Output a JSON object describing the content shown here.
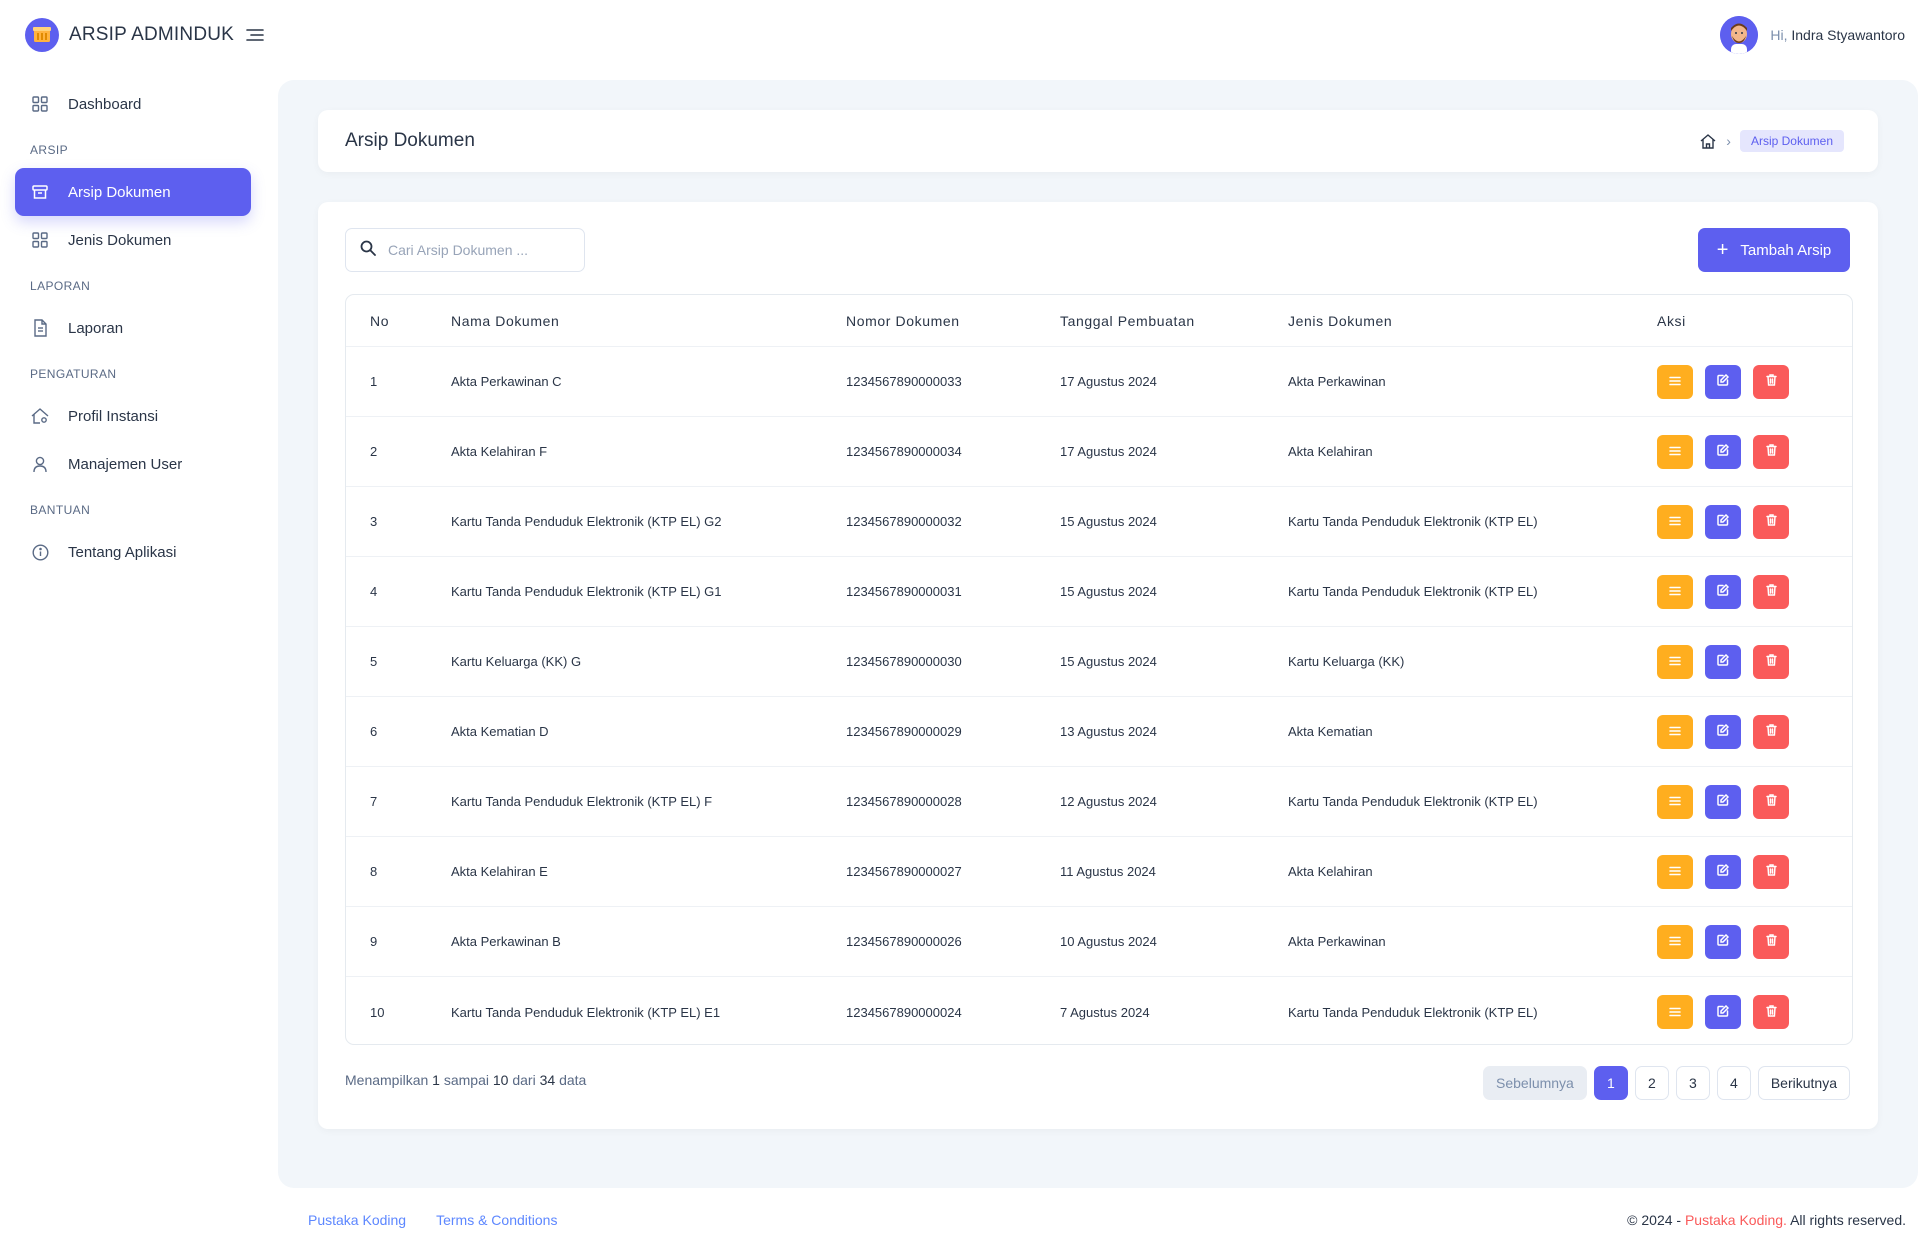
{
  "app": {
    "brand": "ARSIP ADMINDUK",
    "greeting": "Hi,",
    "user_name": "Indra Styawantoro"
  },
  "sidebar": {
    "dashboard": "Dashboard",
    "sections": {
      "arsip": "ARSIP",
      "laporan": "LAPORAN",
      "pengaturan": "PENGATURAN",
      "bantuan": "BANTUAN"
    },
    "items": {
      "arsip_dokumen": "Arsip Dokumen",
      "jenis_dokumen": "Jenis Dokumen",
      "laporan": "Laporan",
      "profil_instansi": "Profil Instansi",
      "manajemen_user": "Manajemen User",
      "tentang_aplikasi": "Tentang Aplikasi"
    }
  },
  "page": {
    "title": "Arsip Dokumen",
    "breadcrumb_current": "Arsip Dokumen"
  },
  "toolbar": {
    "search_placeholder": "Cari Arsip Dokumen ...",
    "add_label": "Tambah Arsip"
  },
  "table": {
    "headers": {
      "no": "No",
      "name": "Nama Dokumen",
      "number": "Nomor Dokumen",
      "date": "Tanggal Pembuatan",
      "type": "Jenis Dokumen",
      "action": "Aksi"
    },
    "rows": [
      {
        "no": "1",
        "name": "Akta Perkawinan C",
        "number": "1234567890000033",
        "date": "17 Agustus 2024",
        "type": "Akta Perkawinan"
      },
      {
        "no": "2",
        "name": "Akta Kelahiran F",
        "number": "1234567890000034",
        "date": "17 Agustus 2024",
        "type": "Akta Kelahiran"
      },
      {
        "no": "3",
        "name": "Kartu Tanda Penduduk Elektronik (KTP EL) G2",
        "number": "1234567890000032",
        "date": "15 Agustus 2024",
        "type": "Kartu Tanda Penduduk Elektronik (KTP EL)"
      },
      {
        "no": "4",
        "name": "Kartu Tanda Penduduk Elektronik (KTP EL) G1",
        "number": "1234567890000031",
        "date": "15 Agustus 2024",
        "type": "Kartu Tanda Penduduk Elektronik (KTP EL)"
      },
      {
        "no": "5",
        "name": "Kartu Keluarga (KK) G",
        "number": "1234567890000030",
        "date": "15 Agustus 2024",
        "type": "Kartu Keluarga (KK)"
      },
      {
        "no": "6",
        "name": "Akta Kematian D",
        "number": "1234567890000029",
        "date": "13 Agustus 2024",
        "type": "Akta Kematian"
      },
      {
        "no": "7",
        "name": "Kartu Tanda Penduduk Elektronik (KTP EL) F",
        "number": "1234567890000028",
        "date": "12 Agustus 2024",
        "type": "Kartu Tanda Penduduk Elektronik (KTP EL)"
      },
      {
        "no": "8",
        "name": "Akta Kelahiran E",
        "number": "1234567890000027",
        "date": "11 Agustus 2024",
        "type": "Akta Kelahiran"
      },
      {
        "no": "9",
        "name": "Akta Perkawinan B",
        "number": "1234567890000026",
        "date": "10 Agustus 2024",
        "type": "Akta Perkawinan"
      },
      {
        "no": "10",
        "name": "Kartu Tanda Penduduk Elektronik (KTP EL) E1",
        "number": "1234567890000024",
        "date": "7 Agustus 2024",
        "type": "Kartu Tanda Penduduk Elektronik (KTP EL)"
      }
    ]
  },
  "info": {
    "prefix": "Menampilkan",
    "from": "1",
    "mid1": "sampai",
    "to": "10",
    "mid2": "dari",
    "total": "34",
    "suffix": "data"
  },
  "pagination": {
    "prev": "Sebelumnya",
    "pages": [
      "1",
      "2",
      "3",
      "4"
    ],
    "current": "1",
    "next": "Berikutnya"
  },
  "footer": {
    "link1": "Pustaka Koding",
    "link2": "Terms & Conditions",
    "copy_prefix": "© 2024 -",
    "copy_brand": "Pustaka Koding.",
    "copy_suffix": "All rights reserved."
  },
  "colors": {
    "primary": "#5d5fef",
    "warning": "#ffae1f",
    "danger": "#fa5a5a",
    "link": "#5d87ff",
    "background": "#f2f6fa"
  },
  "icons": {
    "brand": "archive-box-icon",
    "menu": "menu-toggle-icon",
    "view": "list-icon",
    "edit": "edit-icon",
    "delete": "trash-icon"
  }
}
